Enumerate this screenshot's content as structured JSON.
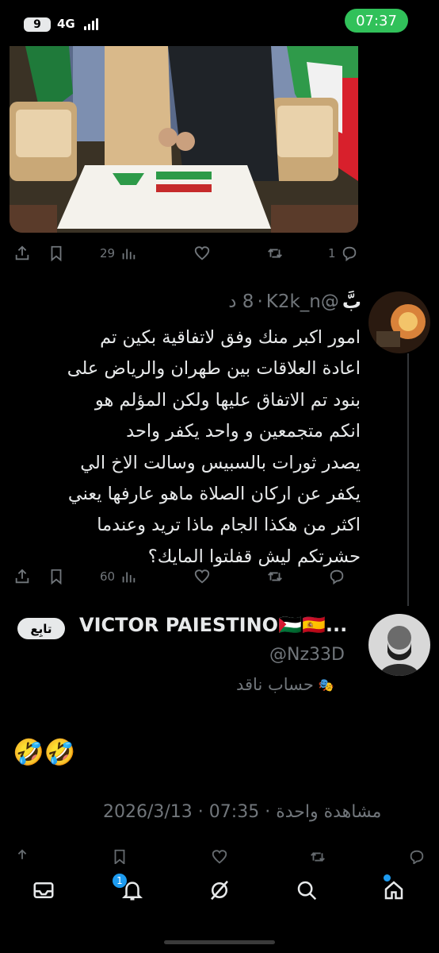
{
  "status_bar": {
    "battery": "9",
    "network": "4G",
    "time": "07:37"
  },
  "quoted_tweet": {
    "image_desc": "ceremony-photo",
    "actions": {
      "views": "29",
      "replies": "1"
    }
  },
  "reply": {
    "name": "بَّ",
    "handle": "@K2k_n",
    "age": "8 د",
    "separator": "·",
    "body": "امور اكبر منك وفق لاتفاقية بكين تم\nاعادة العلاقات بين طهران والرياض على\nبنود تم الاتفاق عليها ولكن المؤلم هو\nانكم متجمعين و واحد يكفر واحد\nيصدر ثورات بالسبيس وسالت الاخ الي\nيكفر عن اركان الصلاة ماهو عارفها يعني\nاكثر من هكذا الجام ماذا تريد وعندما\nحشرتكم ليش قفلتوا المايك؟",
    "actions": {
      "views": "60"
    },
    "more": "···"
  },
  "main_tweet": {
    "name": "VICTOR PAIESTINO🇵🇸🇪🇸...",
    "handle": "@Nz33D",
    "label": "حساب ناقد",
    "label_icon": "🎭",
    "follow_label": "تابِع",
    "content": "🤣🤣",
    "meta_date": "2026/3/13",
    "meta_time": "07:35",
    "meta_views": "مشاهدة واحدة",
    "meta_sep": " · "
  },
  "bottom_nav": {
    "notifications_badge": "1",
    "items": [
      "messages-icon",
      "notifications-icon",
      "grok-icon",
      "search-icon",
      "home-icon"
    ]
  },
  "colors": {
    "background": "#000000",
    "text": "#e7e9ea",
    "muted": "#71767b",
    "accent": "#1d9bf0",
    "clock_pill": "#31c15a"
  }
}
